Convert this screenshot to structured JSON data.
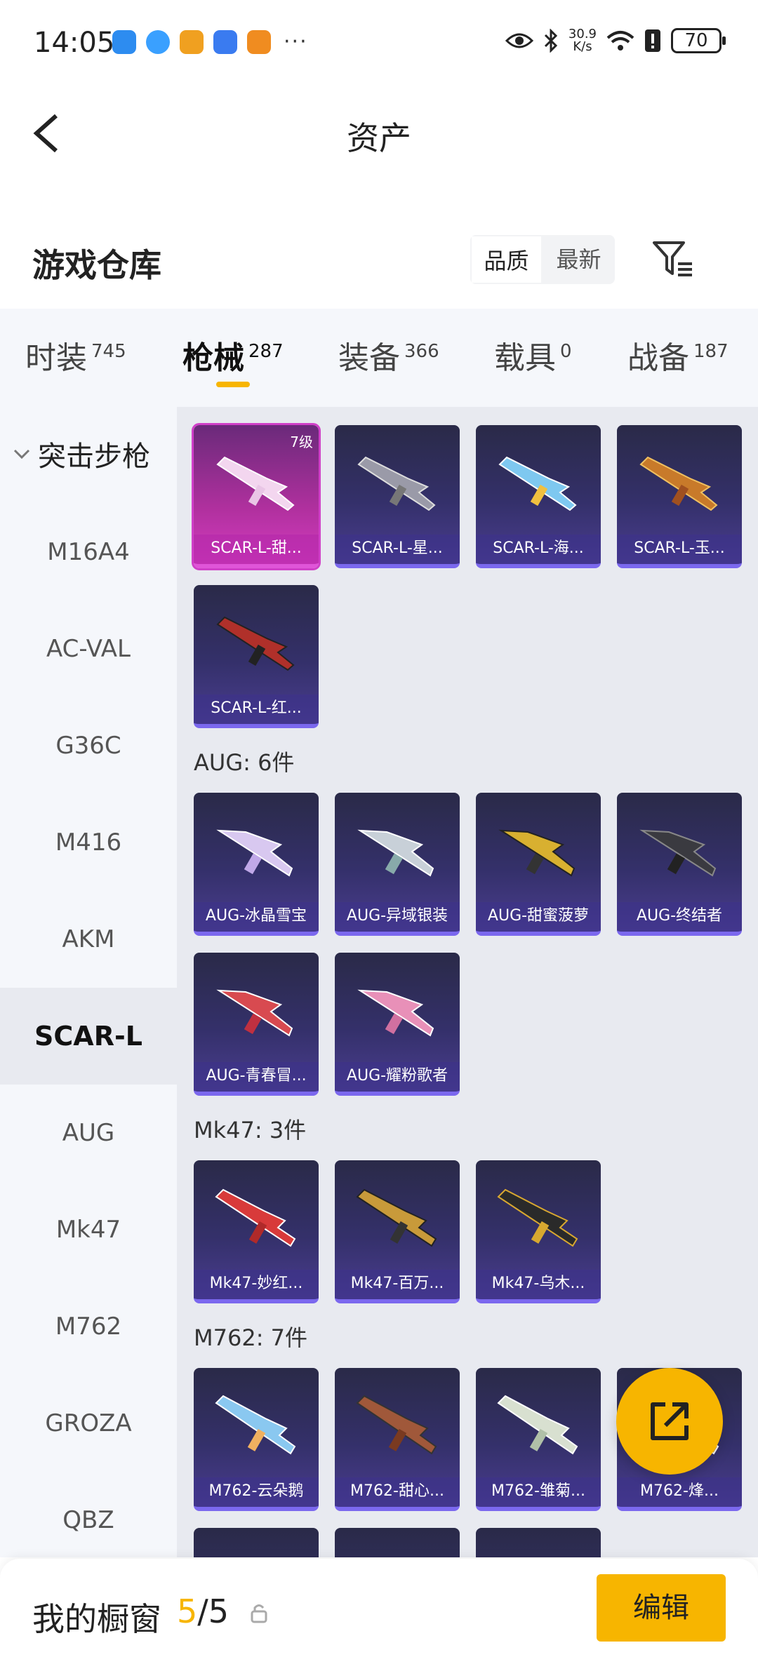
{
  "status": {
    "time": "14:05",
    "speed_value": "30.9",
    "speed_unit": "K/s",
    "battery": "70",
    "more_dots": "···",
    "app_colors": [
      "#2d8cf0",
      "#3aa0ff",
      "#f0a020",
      "#3a7bf0",
      "#f08c20"
    ]
  },
  "header": {
    "title": "资产"
  },
  "warehouse": {
    "title": "游戏仓库",
    "sort_options": [
      "品质",
      "最新"
    ]
  },
  "tabs": [
    {
      "label": "时装",
      "count": "745"
    },
    {
      "label": "枪械",
      "count": "287"
    },
    {
      "label": "装备",
      "count": "366"
    },
    {
      "label": "载具",
      "count": "0"
    },
    {
      "label": "战备",
      "count": "187"
    }
  ],
  "sidebar": {
    "group": "突击步枪",
    "items": [
      "M16A4",
      "AC-VAL",
      "G36C",
      "M416",
      "AKM",
      "SCAR-L",
      "AUG",
      "Mk47",
      "M762",
      "GROZA",
      "QBZ"
    ]
  },
  "grid": {
    "scar_level_badge": "7级",
    "scar_items": [
      "SCAR-L-甜...",
      "SCAR-L-星...",
      "SCAR-L-海...",
      "SCAR-L-玉...",
      "SCAR-L-红..."
    ],
    "aug_label": "AUG: 6件",
    "aug_items": [
      "AUG-冰晶雪宝",
      "AUG-异域银装",
      "AUG-甜蜜菠萝",
      "AUG-终结者",
      "AUG-青春冒...",
      "AUG-耀粉歌者"
    ],
    "mk47_label": "Mk47: 3件",
    "mk47_items": [
      "Mk47-妙红...",
      "Mk47-百万...",
      "Mk47-乌木..."
    ],
    "m762_label": "M762: 7件",
    "m762_items": [
      "M762-云朵鹅",
      "M762-甜心...",
      "M762-雏菊...",
      "M762-烽..."
    ]
  },
  "bottom": {
    "label": "我的橱窗",
    "current": "5",
    "total": "/5",
    "edit": "编辑"
  },
  "colors": {
    "accent": "#f7b500",
    "card_bg": "#34306a",
    "card_pink": "#d43cc0"
  }
}
